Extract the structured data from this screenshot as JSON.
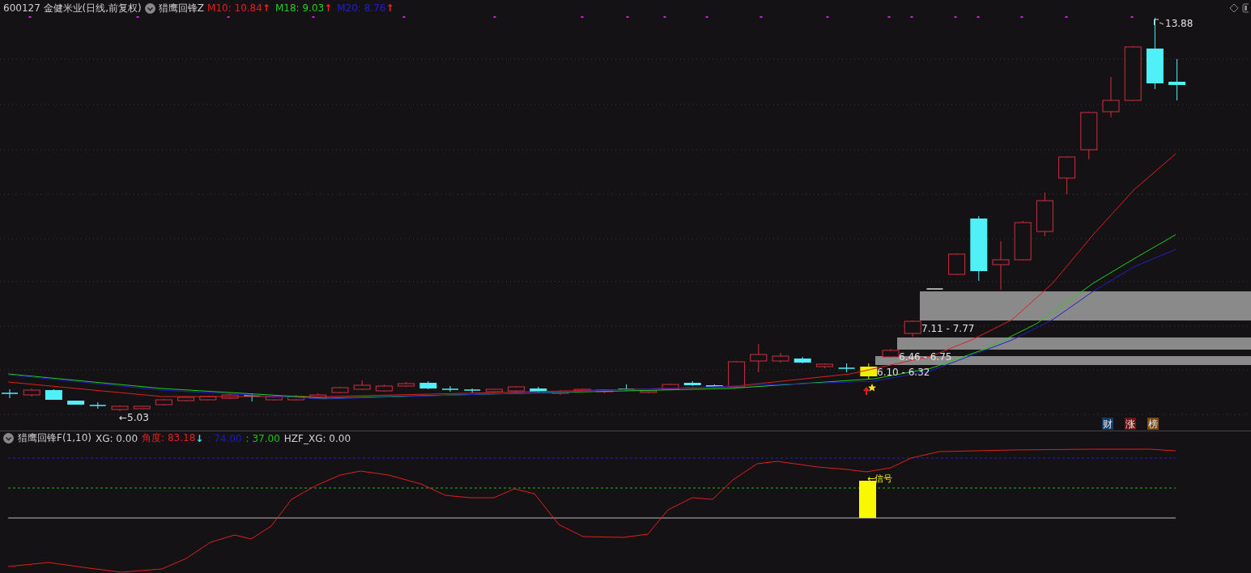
{
  "header": {
    "symbol": "600127",
    "name": "金健米业(日线,前复权)",
    "indicator": "猎鹰回锋Z",
    "averages": [
      {
        "label": "M10: 10.84",
        "color": "#e02020",
        "arrow": {
          "text": "↑",
          "color": "#ff2020"
        }
      },
      {
        "label": "M18: 9.03",
        "color": "#20d020",
        "arrow": {
          "text": "↑",
          "color": "#ff2020"
        }
      },
      {
        "label": "M20: 8.76",
        "color": "#2020c8",
        "arrow": {
          "text": "↑",
          "color": "#ff2020"
        }
      }
    ]
  },
  "price_chart": {
    "high_label": "13.88",
    "low_label": "←5.03",
    "zones": [
      {
        "label": "7.11 - 7.77"
      },
      {
        "label": "6.46 - 6.75"
      },
      {
        "label": "6.10 - 6.32"
      }
    ],
    "badges": [
      {
        "label": "财",
        "color": "#123d66"
      },
      {
        "label": "涨",
        "color": "#6e1212"
      },
      {
        "label": "榜",
        "color": "#7a4a12"
      }
    ]
  },
  "indicator_panel": {
    "title": "猎鹰回锋F(1,10)",
    "values": [
      {
        "text": "XG: 0.00",
        "color": "#d0d0d0"
      },
      {
        "text": "角度: 83.18",
        "color": "#e02020",
        "arrow": {
          "text": "↓",
          "color": "#40e0f0"
        }
      },
      {
        "text": ": 74.00",
        "color": "#1a1ac8"
      },
      {
        "text": ": 37.00",
        "color": "#20c020"
      },
      {
        "text": "HZF_XG: 0.00",
        "color": "#d0d0d0"
      }
    ],
    "signal_label": "←信号"
  }
}
